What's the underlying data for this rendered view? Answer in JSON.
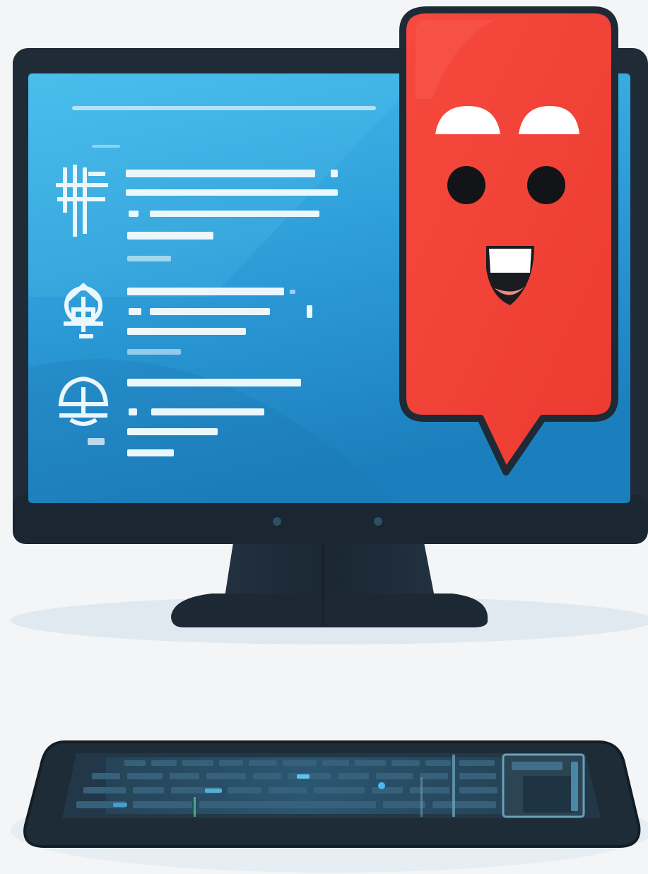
{
  "scene": {
    "subject": "desktop-computer-with-chat-mascot",
    "colors": {
      "background": "#f4f5f6",
      "floor_shadow": "#dfe9ef",
      "bezel": "#1f2c38",
      "bezel_dark": "#15202a",
      "screen_top": "#3bb4e6",
      "screen_bottom": "#1f86c4",
      "screen_lines": "#eaf7fd",
      "mascot_red": "#f2453a",
      "mascot_outline": "#1e2a35",
      "keyboard_body": "#1d2c37",
      "keyboard_keys": "#2c4a5c",
      "keyboard_glow": "#3fa0d8"
    },
    "icons": [
      "text-document-icon",
      "robot-assistant-icon",
      "user-profile-icon",
      "speech-bubble-icon"
    ],
    "mascot_expression": "happy-smiling"
  }
}
